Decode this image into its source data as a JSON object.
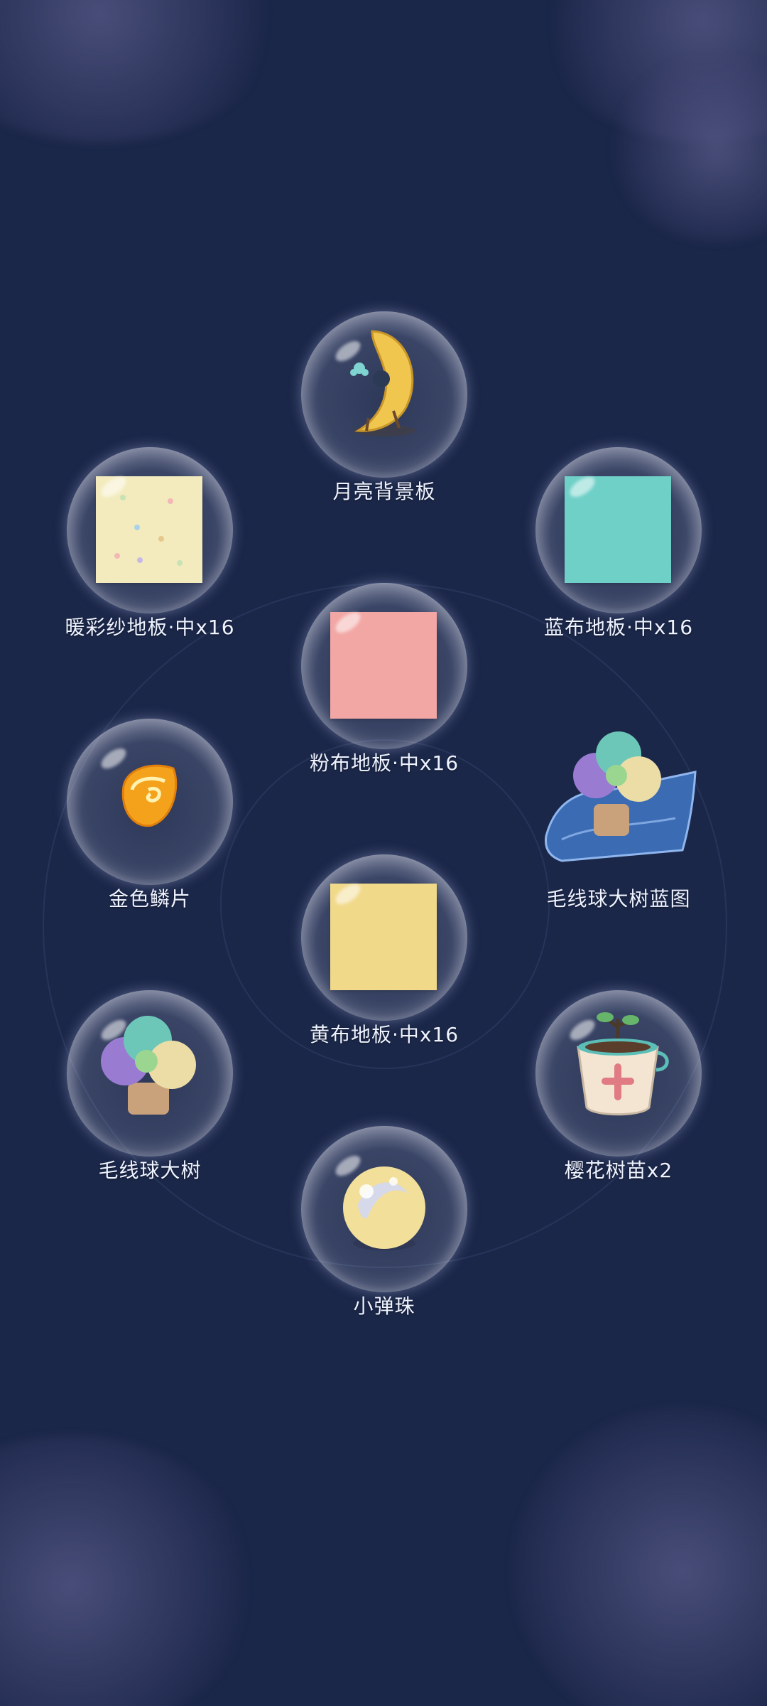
{
  "rewards": {
    "moon_board": {
      "label": "月亮背景板",
      "icon": "moon-board-icon",
      "color": "#f1c64f"
    },
    "warm_floor": {
      "label": "暖彩纱地板·中x16",
      "icon": "warm-gauze-floor-tile",
      "color": "#f3ebbd"
    },
    "blue_floor": {
      "label": "蓝布地板·中x16",
      "icon": "blue-cloth-floor-tile",
      "color": "#6fd0c8"
    },
    "pink_floor": {
      "label": "粉布地板·中x16",
      "icon": "pink-cloth-floor-tile",
      "color": "#f2a7a4"
    },
    "gold_scale": {
      "label": "金色鳞片",
      "icon": "gold-scale-icon",
      "color": "#f4a21c"
    },
    "yarn_tree_blueprint": {
      "label": "毛线球大树蓝图",
      "icon": "yarn-tree-blueprint-icon",
      "color": "#3b6bb3"
    },
    "yellow_floor": {
      "label": "黄布地板·中x16",
      "icon": "yellow-cloth-floor-tile",
      "color": "#f1d98a"
    },
    "yarn_tree": {
      "label": "毛线球大树",
      "icon": "yarn-tree-icon",
      "color": "#8fd4c3"
    },
    "sakura_sapling": {
      "label": "樱花树苗x2",
      "icon": "sakura-sapling-pot-icon",
      "color": "#f3e5d2"
    },
    "marble": {
      "label": "小弹珠",
      "icon": "marble-icon",
      "color": "#f2df9a"
    }
  }
}
